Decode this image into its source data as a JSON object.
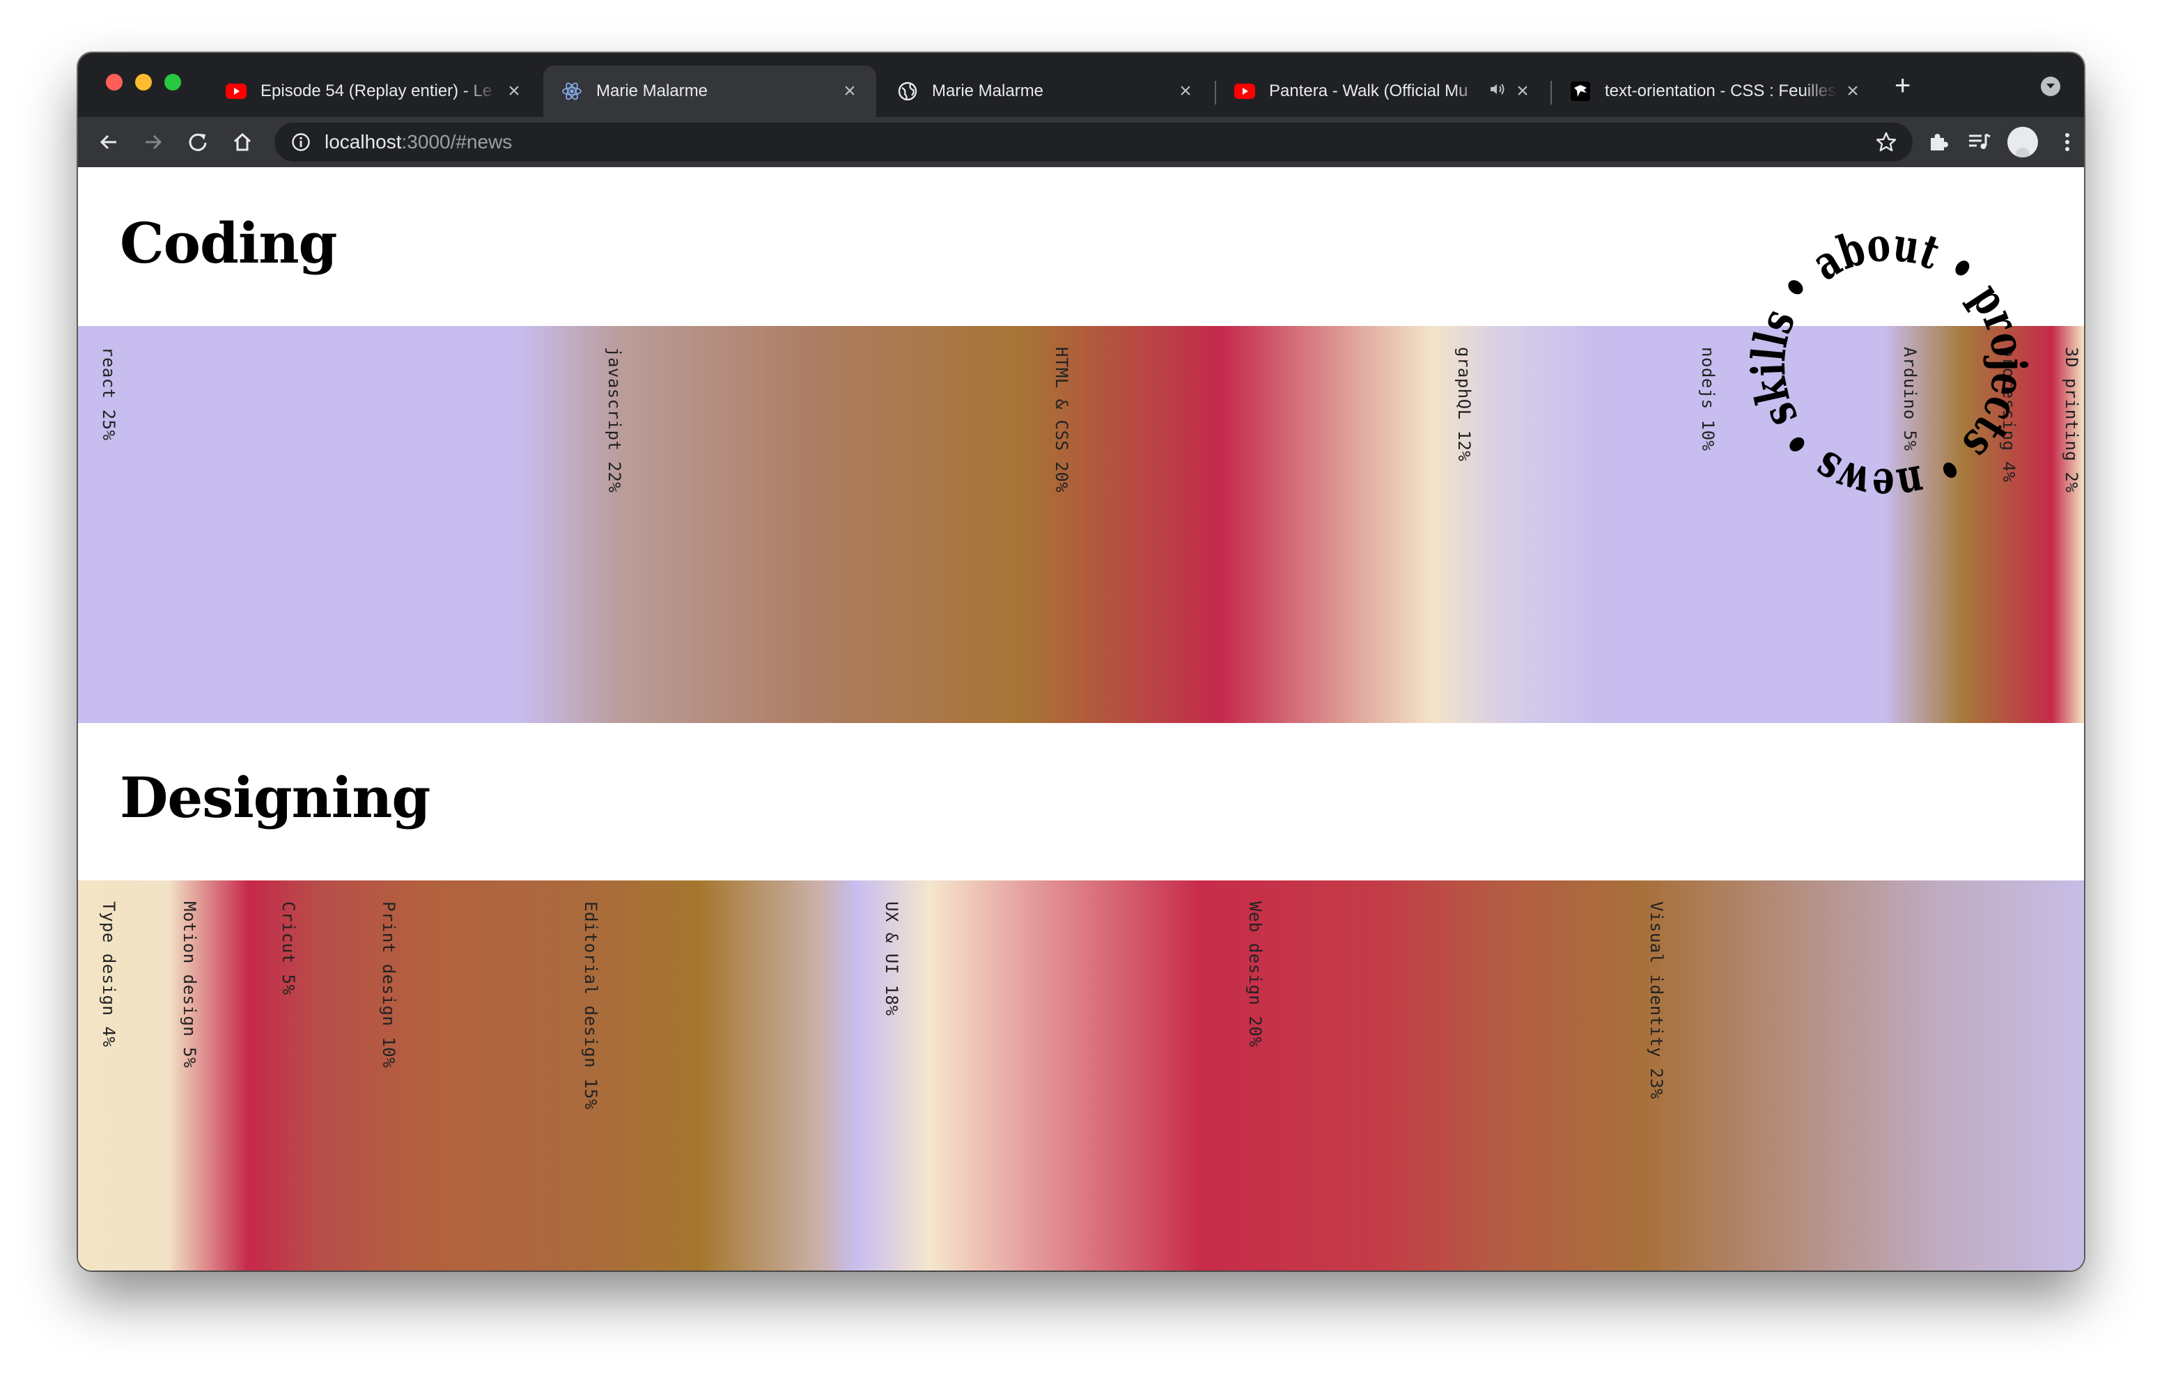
{
  "browser": {
    "tabs": [
      {
        "title": "Episode 54 (Replay entier) - Le",
        "favicon": "youtube-icon",
        "active": false
      },
      {
        "title": "Marie Malarme",
        "favicon": "react-icon",
        "active": true
      },
      {
        "title": "Marie Malarme",
        "favicon": "globe-icon",
        "active": false
      },
      {
        "title": "Pantera - Walk (Official Mu",
        "favicon": "youtube-icon",
        "active": false,
        "audio": true
      },
      {
        "title": "text-orientation - CSS : Feuilles",
        "favicon": "mdn-icon",
        "active": false
      }
    ],
    "close_glyph": "×",
    "new_tab_glyph": "+",
    "url_host": "localhost",
    "url_path": ":3000/#news"
  },
  "page": {
    "sections": [
      {
        "heading": "Coding",
        "skills": [
          "react 25%",
          "javascript 22%",
          "HTML & CSS 20%",
          "graphQL 12%",
          "nodejs 10%",
          "Arduino 5%",
          "processing 4%",
          "3D printing 2%"
        ]
      },
      {
        "heading": "Designing",
        "skills": [
          "Type design 4%",
          "Motion design 5%",
          "Cricut 5%",
          "Print design 10%",
          "Editorial design 15%",
          "UX & UI 18%",
          "Web design 20%",
          "Visual identity 23%"
        ]
      }
    ],
    "nav_ring": {
      "text": "skills • about • projects • news •",
      "items": [
        "skills",
        "about",
        "projects",
        "news"
      ]
    }
  },
  "colors": {
    "lilac": "#c7bdee",
    "crimson": "#c4294c",
    "ochre": "#a77535",
    "cream": "#f3e4c8",
    "chrome_dark": "#202124",
    "chrome_mid": "#35363a"
  }
}
